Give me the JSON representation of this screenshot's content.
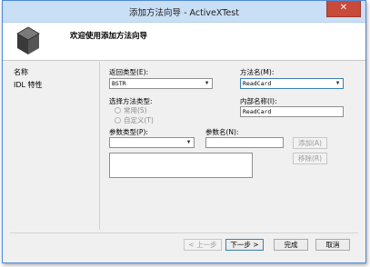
{
  "window": {
    "title": "添加方法向导 - ActiveXTest",
    "close_glyph": "✕"
  },
  "banner": {
    "title": "欢迎使用添加方法向导",
    "icon": "cube-icon"
  },
  "sidebar": {
    "items": [
      {
        "label": "名称"
      },
      {
        "label": "IDL 特性"
      }
    ]
  },
  "form": {
    "return_type": {
      "label": "返回类型(E):",
      "value": "BSTR"
    },
    "method_name": {
      "label": "方法名(M):",
      "value": "ReadCard"
    },
    "method_type": {
      "label": "选择方法类型:",
      "options": [
        {
          "label": "常用(S)"
        },
        {
          "label": "自定义(T)"
        }
      ]
    },
    "internal_name": {
      "label": "内部名称(I):",
      "value": "ReadCard"
    },
    "param_type": {
      "label": "参数类型(P):",
      "value": ""
    },
    "param_name": {
      "label": "参数名(N):",
      "value": ""
    },
    "add_label": "添加(A)",
    "remove_label": "移除(R)"
  },
  "footer": {
    "back_label": "< 上一步",
    "next_label": "下一步 >",
    "finish_label": "完成",
    "cancel_label": "取消"
  },
  "colors": {
    "title_bar": "#c9dff6",
    "close_button": "#c74a3a",
    "window_border": "#4f8ad8"
  }
}
